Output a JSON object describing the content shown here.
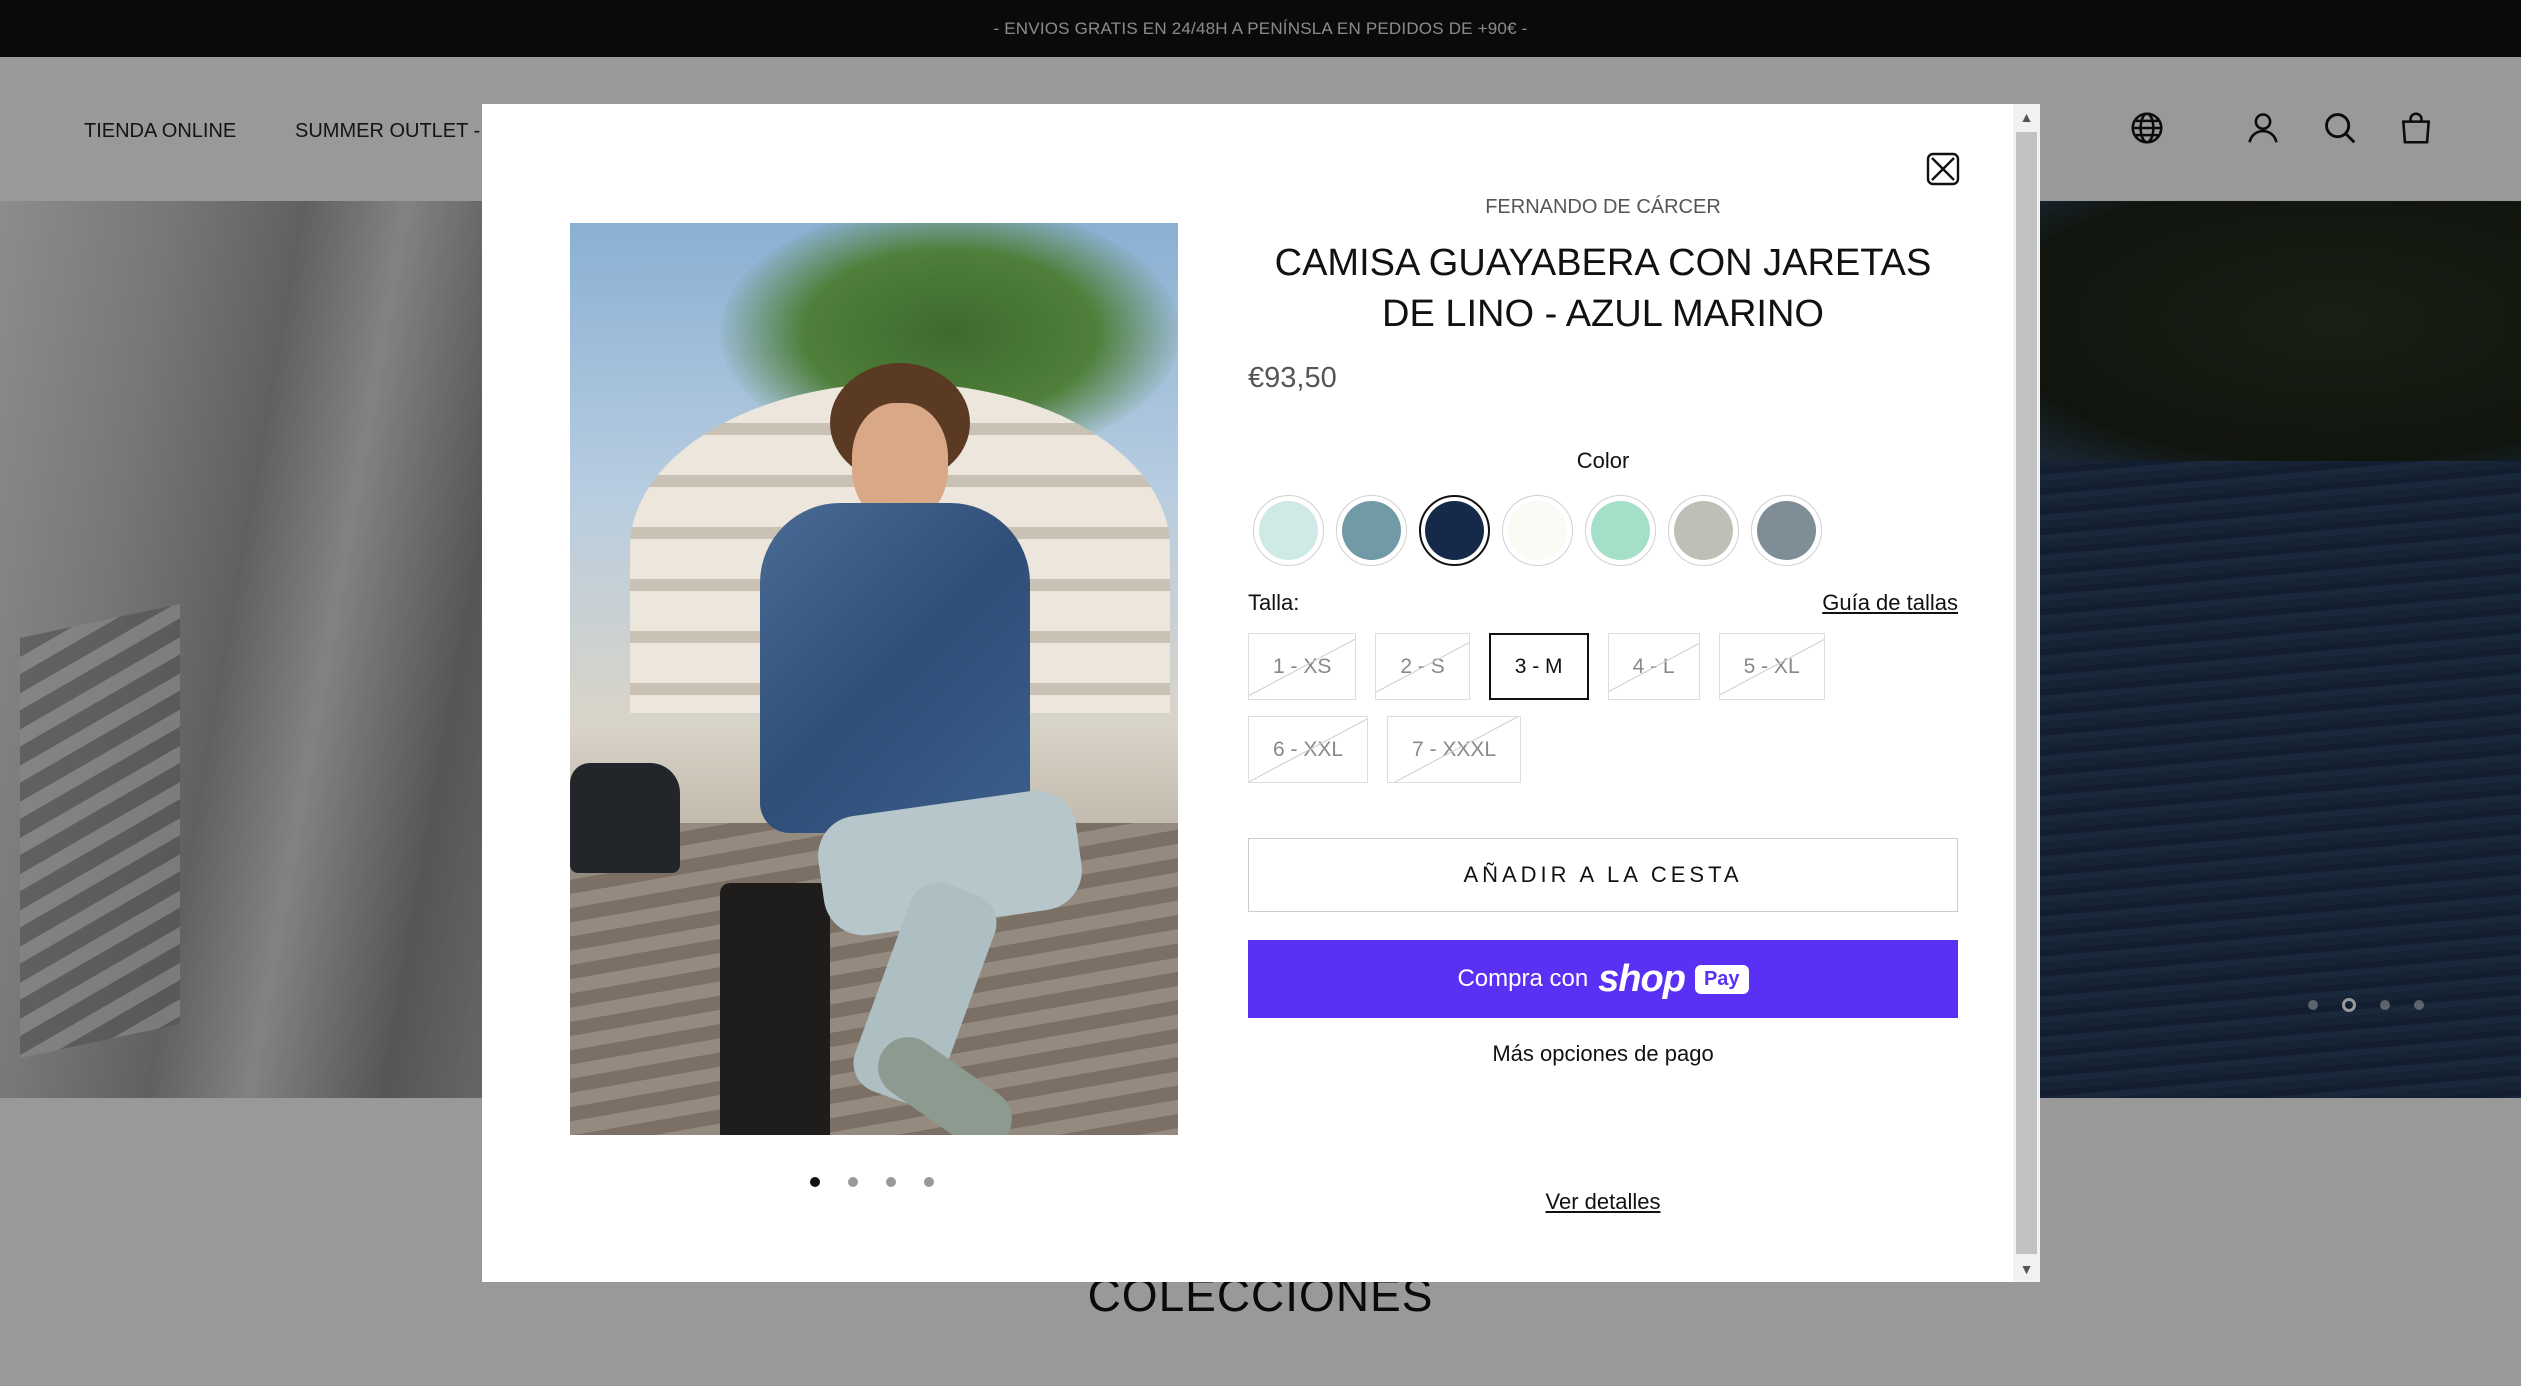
{
  "announcement": "- ENVIOS GRATIS EN 24/48H A PENÍNSLA EN PEDIDOS DE +90€ -",
  "nav": {
    "items": [
      "TIENDA ONLINE",
      "SUMMER OUTLET - HA"
    ]
  },
  "header_icons": [
    "globe-icon",
    "account-icon",
    "search-icon",
    "bag-icon"
  ],
  "hero": {
    "slide_count": 4,
    "active_slide": 2
  },
  "section_title": "COLECCIONES",
  "modal": {
    "vendor": "FERNANDO DE CÁRCER",
    "title": "CAMISA GUAYABERA CON JARETAS DE LINO - AZUL MARINO",
    "price": "€93,50",
    "color_label": "Color",
    "colors": [
      {
        "hex": "#cfe9e7",
        "selected": false
      },
      {
        "hex": "#6f9aa6",
        "selected": false
      },
      {
        "hex": "#152a48",
        "selected": true
      },
      {
        "hex": "#fbfbf6",
        "selected": false
      },
      {
        "hex": "#a4dfc8",
        "selected": false
      },
      {
        "hex": "#bdc0b6",
        "selected": false
      },
      {
        "hex": "#7f8e96",
        "selected": false
      }
    ],
    "size_label": "Talla:",
    "size_guide": "Guía de tallas",
    "sizes": [
      {
        "label": "1 - XS",
        "state": "unavailable"
      },
      {
        "label": "2 - S",
        "state": "unavailable"
      },
      {
        "label": "3 - M",
        "state": "selected"
      },
      {
        "label": "4 - L",
        "state": "unavailable"
      },
      {
        "label": "5 - XL",
        "state": "unavailable"
      },
      {
        "label": "6 - XXL",
        "state": "unavailable"
      },
      {
        "label": "7 - XXXL",
        "state": "unavailable"
      }
    ],
    "add_to_cart": "AÑADIR A LA CESTA",
    "shop_pay": {
      "prefix": "Compra con",
      "brand": "shop",
      "badge": "Pay",
      "color": "#5a31f4"
    },
    "more_payment": "Más opciones de pago",
    "view_details": "Ver detalles",
    "image_slide_count": 4,
    "image_active_slide": 0
  }
}
